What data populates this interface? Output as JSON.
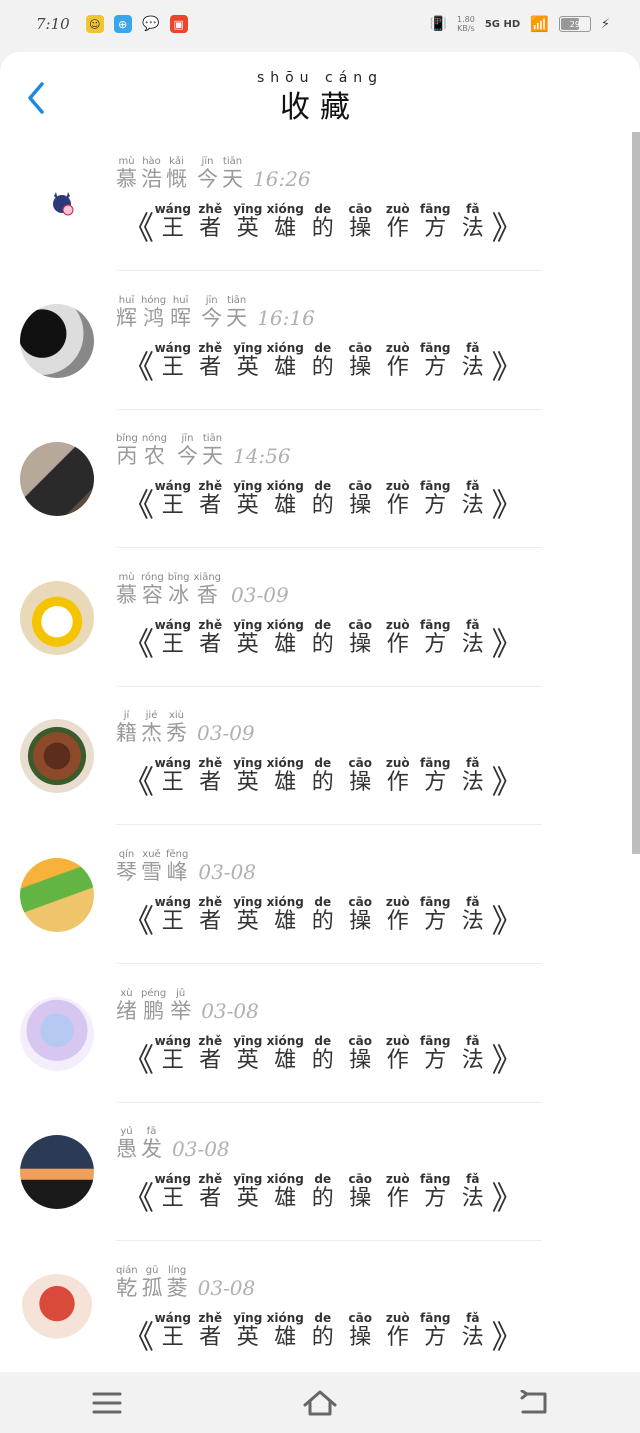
{
  "status": {
    "time": "7:10",
    "net_speed_top": "1.80",
    "net_speed_bottom": "KB/s",
    "signal": "5G HD",
    "battery": "29"
  },
  "header": {
    "title_pinyin": "shōu cáng",
    "title": "收藏"
  },
  "item_title": {
    "open_quote": "《",
    "close_quote": "》",
    "chars": [
      {
        "py": "wáng",
        "hz": "王"
      },
      {
        "py": "zhě",
        "hz": "者"
      },
      {
        "py": "yīng",
        "hz": "英"
      },
      {
        "py": "xióng",
        "hz": "雄"
      },
      {
        "py": "de",
        "hz": "的"
      },
      {
        "py": "cāo",
        "hz": "操"
      },
      {
        "py": "zuò",
        "hz": "作"
      },
      {
        "py": "fāng",
        "hz": "方"
      },
      {
        "py": "fǎ",
        "hz": "法"
      }
    ]
  },
  "items": [
    {
      "avatar": "avatar-1",
      "name": [
        {
          "py": "mù",
          "hz": "慕"
        },
        {
          "py": "hào",
          "hz": "浩"
        },
        {
          "py": "kǎi",
          "hz": "慨"
        }
      ],
      "when": [
        {
          "py": "jīn",
          "hz": "今"
        },
        {
          "py": "tiān",
          "hz": "天"
        }
      ],
      "time": "16:26"
    },
    {
      "avatar": "avatar-2",
      "name": [
        {
          "py": "huī",
          "hz": "辉"
        },
        {
          "py": "hóng",
          "hz": "鸿"
        },
        {
          "py": "huī",
          "hz": "晖"
        }
      ],
      "when": [
        {
          "py": "jīn",
          "hz": "今"
        },
        {
          "py": "tiān",
          "hz": "天"
        }
      ],
      "time": "16:16"
    },
    {
      "avatar": "avatar-3",
      "name": [
        {
          "py": "bǐng",
          "hz": "丙"
        },
        {
          "py": "nóng",
          "hz": "农"
        }
      ],
      "when": [
        {
          "py": "jīn",
          "hz": "今"
        },
        {
          "py": "tiān",
          "hz": "天"
        }
      ],
      "time": "14:56"
    },
    {
      "avatar": "avatar-4",
      "name": [
        {
          "py": "mù",
          "hz": "慕"
        },
        {
          "py": "róng",
          "hz": "容"
        },
        {
          "py": "bīng",
          "hz": "冰"
        },
        {
          "py": "xiāng",
          "hz": "香"
        }
      ],
      "when": [],
      "time": "03-09"
    },
    {
      "avatar": "avatar-5",
      "name": [
        {
          "py": "jí",
          "hz": "籍"
        },
        {
          "py": "jié",
          "hz": "杰"
        },
        {
          "py": "xiù",
          "hz": "秀"
        }
      ],
      "when": [],
      "time": "03-09"
    },
    {
      "avatar": "avatar-6",
      "name": [
        {
          "py": "qín",
          "hz": "琴"
        },
        {
          "py": "xuě",
          "hz": "雪"
        },
        {
          "py": "fēng",
          "hz": "峰"
        }
      ],
      "when": [],
      "time": "03-08"
    },
    {
      "avatar": "avatar-7",
      "name": [
        {
          "py": "xù",
          "hz": "绪"
        },
        {
          "py": "péng",
          "hz": "鹏"
        },
        {
          "py": "jǔ",
          "hz": "举"
        }
      ],
      "when": [],
      "time": "03-08"
    },
    {
      "avatar": "avatar-8",
      "name": [
        {
          "py": "yú",
          "hz": "愚"
        },
        {
          "py": "fā",
          "hz": "发"
        }
      ],
      "when": [],
      "time": "03-08"
    },
    {
      "avatar": "avatar-9",
      "name": [
        {
          "py": "qián",
          "hz": "乾"
        },
        {
          "py": "gū",
          "hz": "孤"
        },
        {
          "py": "líng",
          "hz": "菱"
        }
      ],
      "when": [],
      "time": "03-08"
    }
  ],
  "icons": {
    "back": "chevron-left-icon",
    "menu": "menu-icon",
    "home": "home-icon",
    "return": "back-icon"
  },
  "colors": {
    "accent": "#1e88e5"
  }
}
